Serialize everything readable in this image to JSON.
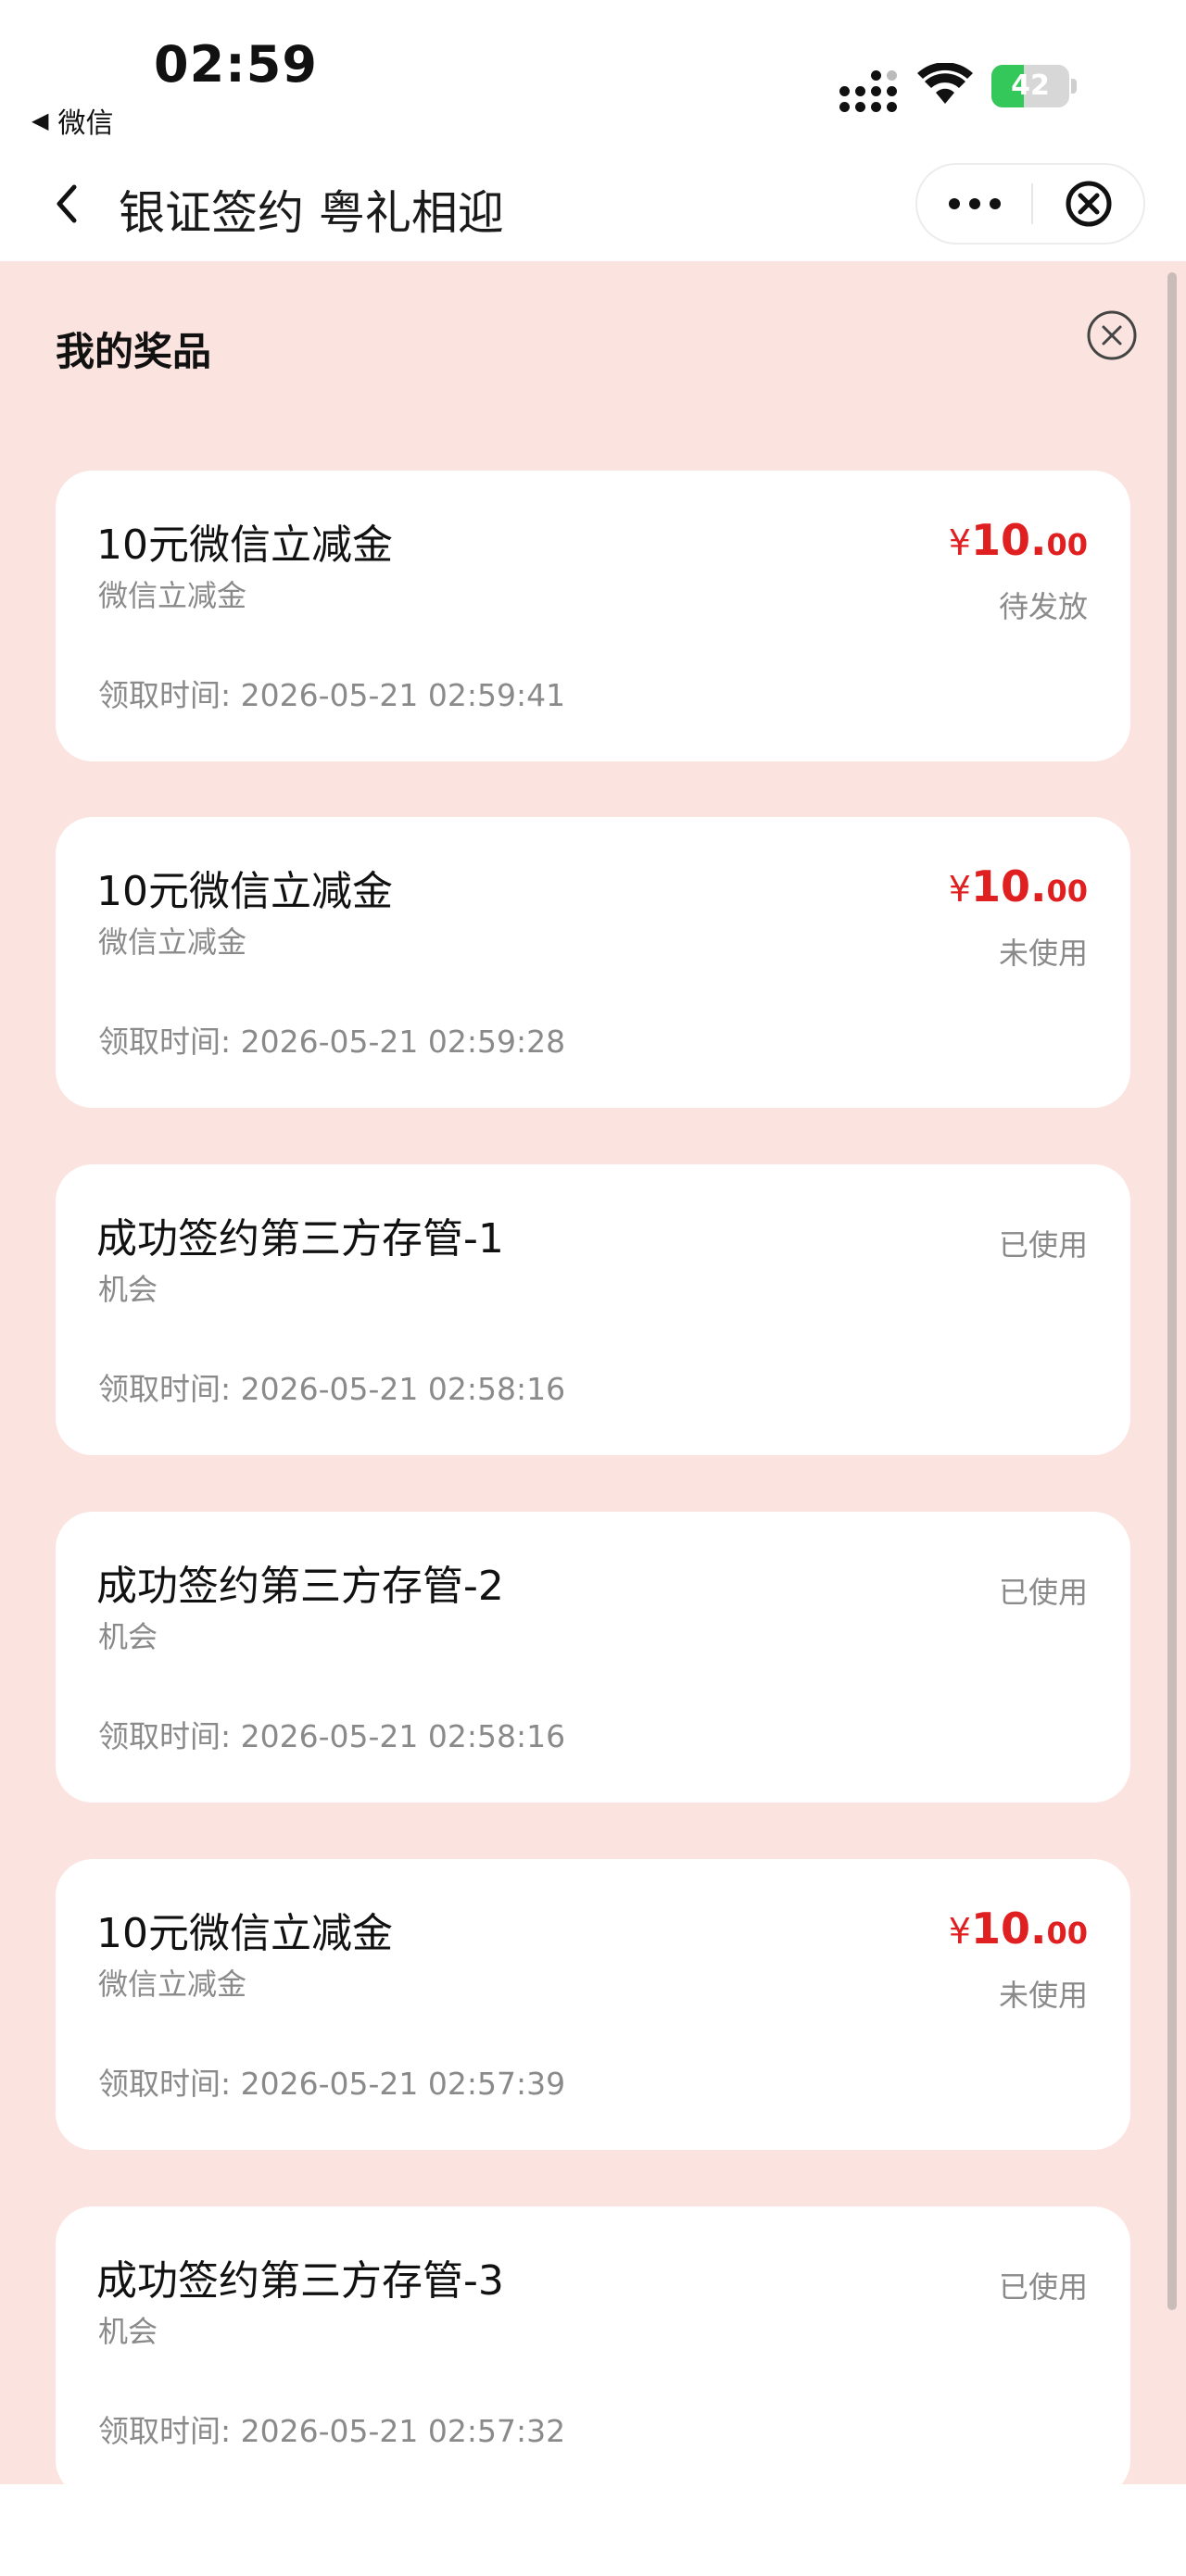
{
  "status_bar": {
    "time": "02:59",
    "back_app_label": "微信",
    "battery_level": "42",
    "battery_fraction": 0.42
  },
  "nav": {
    "title": "银证签约 粤礼相迎"
  },
  "section": {
    "title": "我的奖品"
  },
  "prizes": [
    {
      "name": "10元微信立减金",
      "type": "微信立减金",
      "time": "领取时间: 2026-05-21 02:59:41",
      "yen": "¥",
      "int": "10.",
      "dec": "00",
      "status": "待发放"
    },
    {
      "name": "10元微信立减金",
      "type": "微信立减金",
      "time": "领取时间: 2026-05-21 02:59:28",
      "yen": "¥",
      "int": "10.",
      "dec": "00",
      "status": "未使用"
    },
    {
      "name": "成功签约第三方存管-1",
      "type": "机会",
      "time": "领取时间: 2026-05-21 02:58:16",
      "status": "已使用"
    },
    {
      "name": "成功签约第三方存管-2",
      "type": "机会",
      "time": "领取时间: 2026-05-21 02:58:16",
      "status": "已使用"
    },
    {
      "name": "10元微信立减金",
      "type": "微信立减金",
      "time": "领取时间: 2026-05-21 02:57:39",
      "yen": "¥",
      "int": "10.",
      "dec": "00",
      "status": "未使用"
    },
    {
      "name": "成功签约第三方存管-3",
      "type": "机会",
      "time": "领取时间: 2026-05-21 02:57:32",
      "status": "已使用"
    }
  ],
  "colors": {
    "accent_red": "#e02020",
    "page_bg": "#fbe4df",
    "battery_green": "#34c759"
  }
}
